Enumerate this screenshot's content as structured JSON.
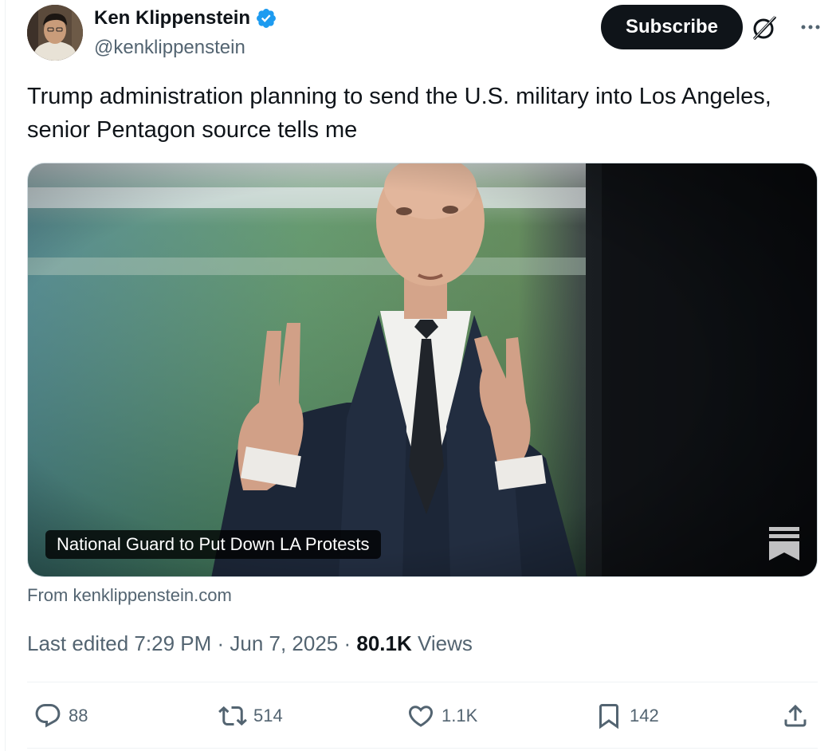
{
  "author": {
    "display_name": "Ken Klippenstein",
    "handle": "@kenklippenstein",
    "verified": true
  },
  "header": {
    "subscribe_label": "Subscribe"
  },
  "tweet": {
    "text": "Trump administration planning to send the U.S. military into Los Angeles, senior Pentagon source tells me"
  },
  "card": {
    "title": "National Guard to Put Down LA Protests",
    "source": "From kenklippenstein.com"
  },
  "meta": {
    "edited": "Last edited 7:29 PM · Jun 7, 2025 · ",
    "views_count": "80.1K",
    "views_label": " Views"
  },
  "actions": {
    "replies": "88",
    "reposts": "514",
    "likes": "1.1K",
    "bookmarks": "142"
  },
  "colors": {
    "verified_blue": "#1d9bf0",
    "secondary_text": "#536471",
    "primary_text": "#0f1419"
  },
  "icons": [
    "verified-badge-icon",
    "grok-icon",
    "more-icon",
    "substack-icon",
    "reply-icon",
    "repost-icon",
    "like-icon",
    "bookmark-icon",
    "share-icon"
  ]
}
